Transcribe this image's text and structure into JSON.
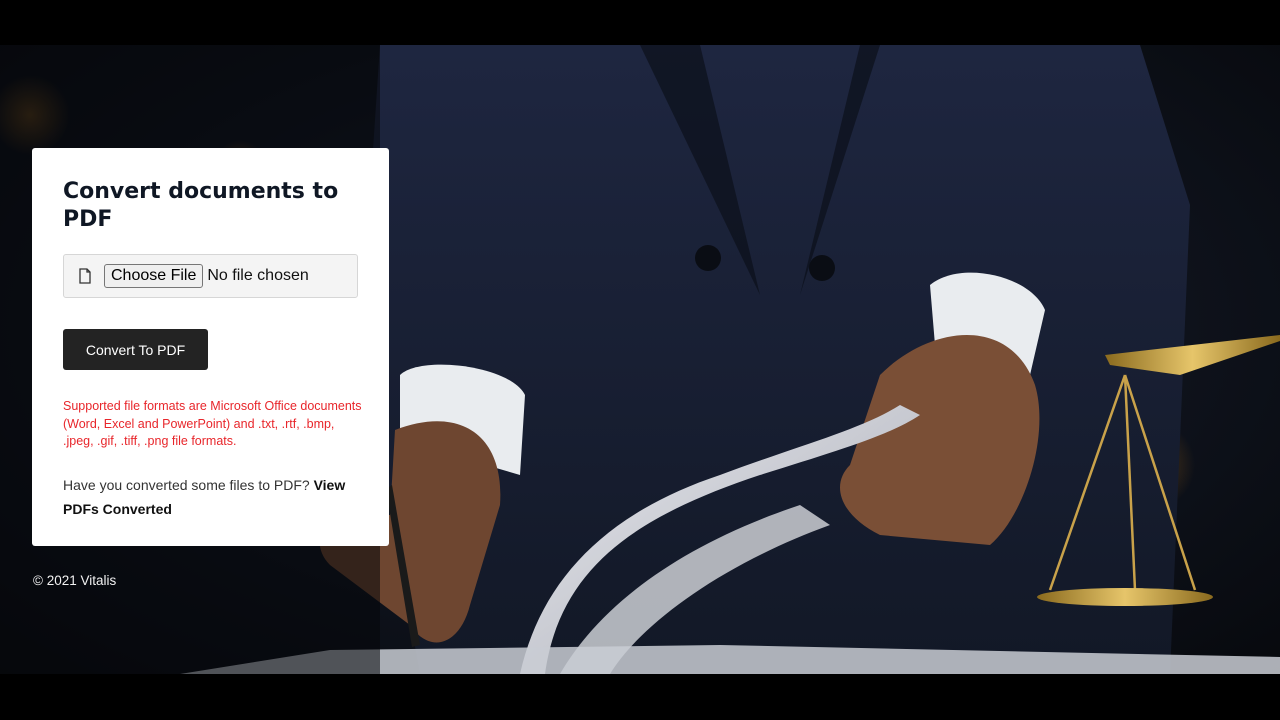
{
  "card": {
    "title": "Convert documents to PDF",
    "file_input": {
      "button_label": "Choose File",
      "status_text": "No file chosen"
    },
    "convert_button_label": "Convert To PDF",
    "formats_notice": "Supported file formats are Microsoft Office documents (Word, Excel and PowerPoint) and .txt, .rtf, .bmp, .jpeg, .gif, .tiff, .png file formats.",
    "converted_prompt": "Have you converted some files to PDF?",
    "converted_link": "View PDFs Converted"
  },
  "footer": {
    "copyright": "© 2021 Vitalis"
  },
  "icons": {
    "file": "file-icon"
  },
  "colors": {
    "button_bg": "#232323",
    "notice_text": "#e8262b",
    "card_bg": "#ffffff"
  }
}
